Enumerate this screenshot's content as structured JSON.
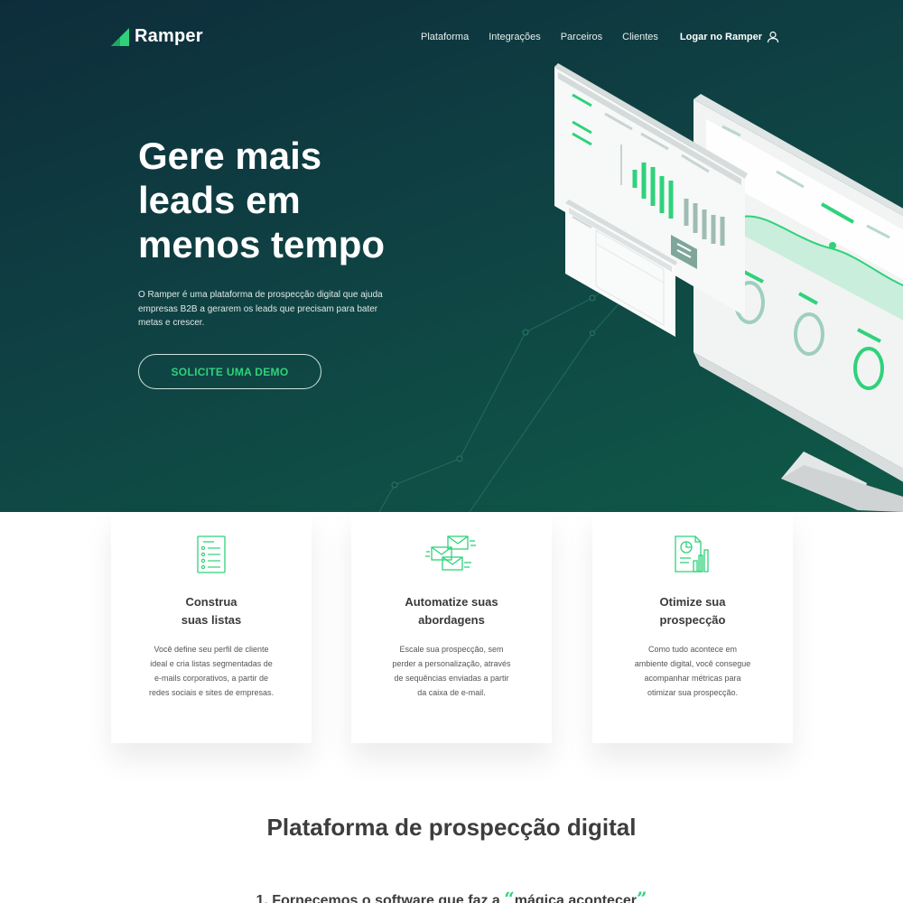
{
  "brand": {
    "name": "Ramper",
    "accent": "#2fd27b"
  },
  "nav": {
    "items": [
      "Plataforma",
      "Integrações",
      "Parceiros",
      "Clientes"
    ],
    "login": "Logar no Ramper",
    "login_icon": "user-icon"
  },
  "hero": {
    "title_lines": [
      "Gere mais",
      "leads em",
      "menos tempo"
    ],
    "description": "O Ramper é uma plataforma de prospecção digital que ajuda empresas B2B a gerarem os leads que precisam para bater metas e crescer.",
    "cta": "SOLICITE UMA DEMO"
  },
  "features": [
    {
      "icon": "list-document-icon",
      "title_lines": [
        "Construa",
        "suas listas"
      ],
      "text_lines": [
        "Você define seu perfil de cliente",
        "ideal e cria listas segmentadas de",
        "e-mails corporativos, a partir de",
        "redes sociais e sites de empresas."
      ]
    },
    {
      "icon": "envelopes-icon",
      "title_lines": [
        "Automatize suas",
        "abordagens"
      ],
      "text_lines": [
        "Escale sua prospecção, sem",
        "perder a personalização, através",
        "de sequências enviadas a partir",
        "da caixa de e-mail."
      ]
    },
    {
      "icon": "report-chart-icon",
      "title_lines": [
        "Otimize sua",
        "prospecção"
      ],
      "text_lines": [
        "Como tudo acontece em",
        "ambiente digital, você consegue",
        "acompanhar métricas para",
        "otimizar sua prospecção."
      ]
    }
  ],
  "section": {
    "title": "Plataforma de prospecção digital",
    "subtitle_prefix": "1. Fornecemos o software que faz a ",
    "subtitle_quote_open": "“",
    "subtitle_highlight": "mágica acontecer",
    "subtitle_quote_close": "”"
  }
}
